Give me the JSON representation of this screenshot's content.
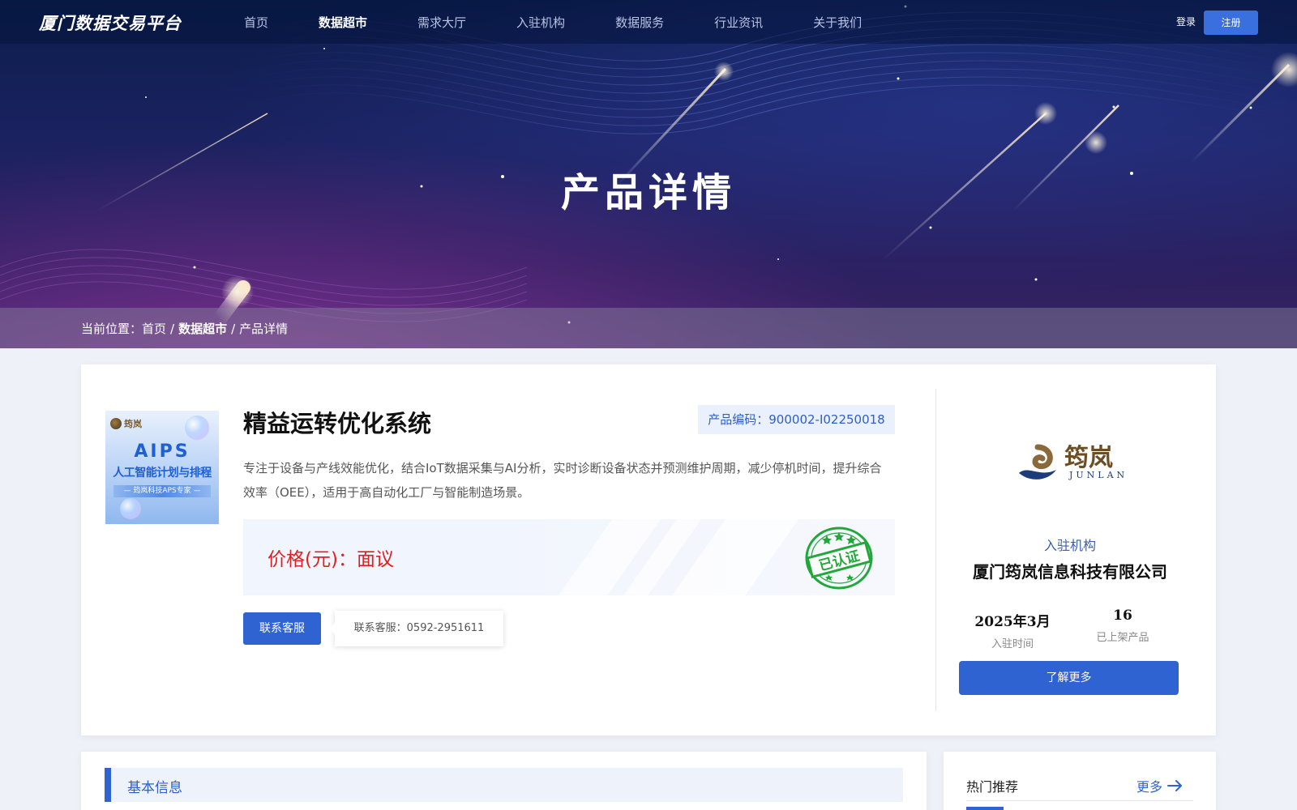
{
  "header": {
    "logo": "厦门数据交易平台",
    "nav": [
      {
        "label": "首页",
        "active": false
      },
      {
        "label": "数据超市",
        "active": true
      },
      {
        "label": "需求大厅",
        "active": false
      },
      {
        "label": "入驻机构",
        "active": false
      },
      {
        "label": "数据服务",
        "active": false
      },
      {
        "label": "行业资讯",
        "active": false
      },
      {
        "label": "关于我们",
        "active": false
      }
    ],
    "login": "登录",
    "register": "注册"
  },
  "hero": {
    "title": "产品详情"
  },
  "breadcrumb": {
    "prefix": "当前位置：",
    "home": "首页",
    "sep": "/",
    "market": "数据超市",
    "current": "产品详情"
  },
  "product": {
    "image": {
      "brand": "筠岚",
      "headline": "AIPS",
      "subtitle": "人工智能计划与排程",
      "tag": "— 筠岚科技APS专家 —"
    },
    "title": "精益运转优化系统",
    "code": "产品编码：900002-I02250018",
    "description": "专注于设备与产线效能优化，结合IoT数据采集与AI分析，实时诊断设备状态并预测维护周期，减少停机时间，提升综合效率（OEE），适用于高自动化工厂与智能制造场景。",
    "price": "价格(元)：面议",
    "cert": "已认证",
    "contact_button": "联系客服",
    "contact_tip": "联系客服：0592-2951611"
  },
  "company": {
    "logo_cn": "筠岚",
    "logo_en": "JUNLAN",
    "kind": "入驻机构",
    "name": "厦门筠岚信息科技有限公司",
    "stats": [
      {
        "value": "2025年3月",
        "label": "入驻时间"
      },
      {
        "value": "16",
        "label": "已上架产品"
      }
    ],
    "learn_more": "了解更多"
  },
  "basic_info": {
    "title": "基本信息"
  },
  "hot": {
    "title": "热门推荐",
    "more": "更多"
  },
  "colors": {
    "primary": "#2f63d1",
    "price_red": "#e02020",
    "cert_green": "#22a83a",
    "nav_bg": "#0b1d4c"
  }
}
